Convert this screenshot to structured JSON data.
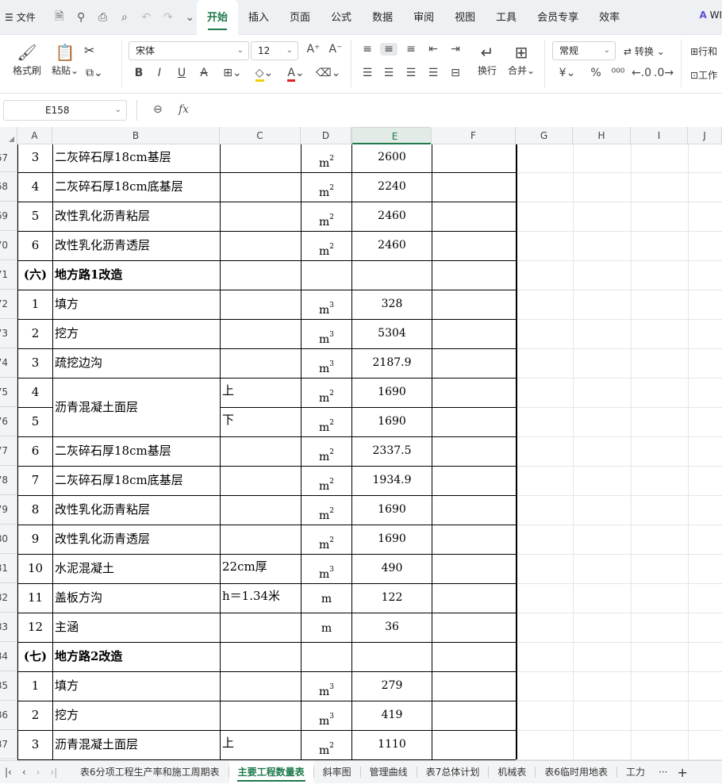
{
  "menubar": {
    "file_label": "文件",
    "tabs": [
      "开始",
      "插入",
      "页面",
      "公式",
      "数据",
      "审阅",
      "视图",
      "工具",
      "会员专享",
      "效率"
    ],
    "active_tab": "开始",
    "brand": "WI"
  },
  "ribbon": {
    "format_painter": "格式刷",
    "paste": "粘贴",
    "font_name": "宋体",
    "font_size": "12",
    "wrap": "换行",
    "merge": "合并",
    "number_format": "常规",
    "convert": "转换",
    "row_col": "行和",
    "worksheet": "工作"
  },
  "formula_bar": {
    "name_box": "E158",
    "fx_label": "fx",
    "formula": ""
  },
  "grid": {
    "columns": [
      "A",
      "B",
      "C",
      "D",
      "E",
      "F",
      "G",
      "H",
      "I",
      "J"
    ],
    "selected_column": "E",
    "row_headers": [
      "67",
      "68",
      "69",
      "70",
      "71",
      "72",
      "73",
      "74",
      "75",
      "76",
      "77",
      "78",
      "79",
      "80",
      "81",
      "82",
      "83",
      "84",
      "85",
      "86",
      "87"
    ],
    "rows": [
      {
        "a": "3",
        "b": "二灰碎石厚18cm基层",
        "c": "",
        "d_base": "m",
        "d_exp": "2",
        "e": "2600",
        "bold": false
      },
      {
        "a": "4",
        "b": "二灰碎石厚18cm底基层",
        "c": "",
        "d_base": "m",
        "d_exp": "2",
        "e": "2240",
        "bold": false
      },
      {
        "a": "5",
        "b": "改性乳化沥青粘层",
        "c": "",
        "d_base": "m",
        "d_exp": "2",
        "e": "2460",
        "bold": false
      },
      {
        "a": "6",
        "b": "改性乳化沥青透层",
        "c": "",
        "d_base": "m",
        "d_exp": "2",
        "e": "2460",
        "bold": false
      },
      {
        "a": "(六)",
        "b": "地方路1改造",
        "c": "",
        "d_base": "",
        "d_exp": "",
        "e": "",
        "bold": true
      },
      {
        "a": "1",
        "b": "填方",
        "c": "",
        "d_base": "m",
        "d_exp": "3",
        "e": "328",
        "bold": false
      },
      {
        "a": "2",
        "b": "挖方",
        "c": "",
        "d_base": "m",
        "d_exp": "3",
        "e": "5304",
        "bold": false
      },
      {
        "a": "3",
        "b": "疏挖边沟",
        "c": "",
        "d_base": "m",
        "d_exp": "3",
        "e": "2187.9",
        "bold": false
      },
      {
        "a": "4",
        "b": "沥青混凝土面层",
        "c": "上",
        "d_base": "m",
        "d_exp": "2",
        "e": "1690",
        "bold": false
      },
      {
        "a": "5",
        "b": "",
        "c": "下",
        "d_base": "m",
        "d_exp": "2",
        "e": "1690",
        "bold": false
      },
      {
        "a": "6",
        "b": "二灰碎石厚18cm基层",
        "c": "",
        "d_base": "m",
        "d_exp": "2",
        "e": "2337.5",
        "bold": false
      },
      {
        "a": "7",
        "b": "二灰碎石厚18cm底基层",
        "c": "",
        "d_base": "m",
        "d_exp": "2",
        "e": "1934.9",
        "bold": false
      },
      {
        "a": "8",
        "b": "改性乳化沥青粘层",
        "c": "",
        "d_base": "m",
        "d_exp": "2",
        "e": "1690",
        "bold": false
      },
      {
        "a": "9",
        "b": "改性乳化沥青透层",
        "c": "",
        "d_base": "m",
        "d_exp": "2",
        "e": "1690",
        "bold": false
      },
      {
        "a": "10",
        "b": "水泥混凝土",
        "c": "22cm厚",
        "d_base": "m",
        "d_exp": "3",
        "e": "490",
        "bold": false
      },
      {
        "a": "11",
        "b": "盖板方沟",
        "c": "h＝1.34米",
        "d_base": "m",
        "d_exp": "",
        "e": "122",
        "bold": false
      },
      {
        "a": "12",
        "b": "主涵",
        "c": "",
        "d_base": "m",
        "d_exp": "",
        "e": "36",
        "bold": false
      },
      {
        "a": "(七)",
        "b": "地方路2改造",
        "c": "",
        "d_base": "",
        "d_exp": "",
        "e": "",
        "bold": true
      },
      {
        "a": "1",
        "b": "填方",
        "c": "",
        "d_base": "m",
        "d_exp": "3",
        "e": "279",
        "bold": false
      },
      {
        "a": "2",
        "b": "挖方",
        "c": "",
        "d_base": "m",
        "d_exp": "3",
        "e": "419",
        "bold": false
      },
      {
        "a": "3",
        "b": "沥青混凝土面层",
        "c": "上",
        "d_base": "m",
        "d_exp": "2",
        "e": "1110",
        "bold": false
      }
    ]
  },
  "sheet_tabs": {
    "tabs": [
      "表6分项工程生产率和施工周期表",
      "主要工程数量表",
      "斜率图",
      "管理曲线",
      "表7总体计划",
      "机械表",
      "表6临时用地表",
      "工力"
    ],
    "active": "主要工程数量表",
    "more": "···",
    "add": "+"
  }
}
